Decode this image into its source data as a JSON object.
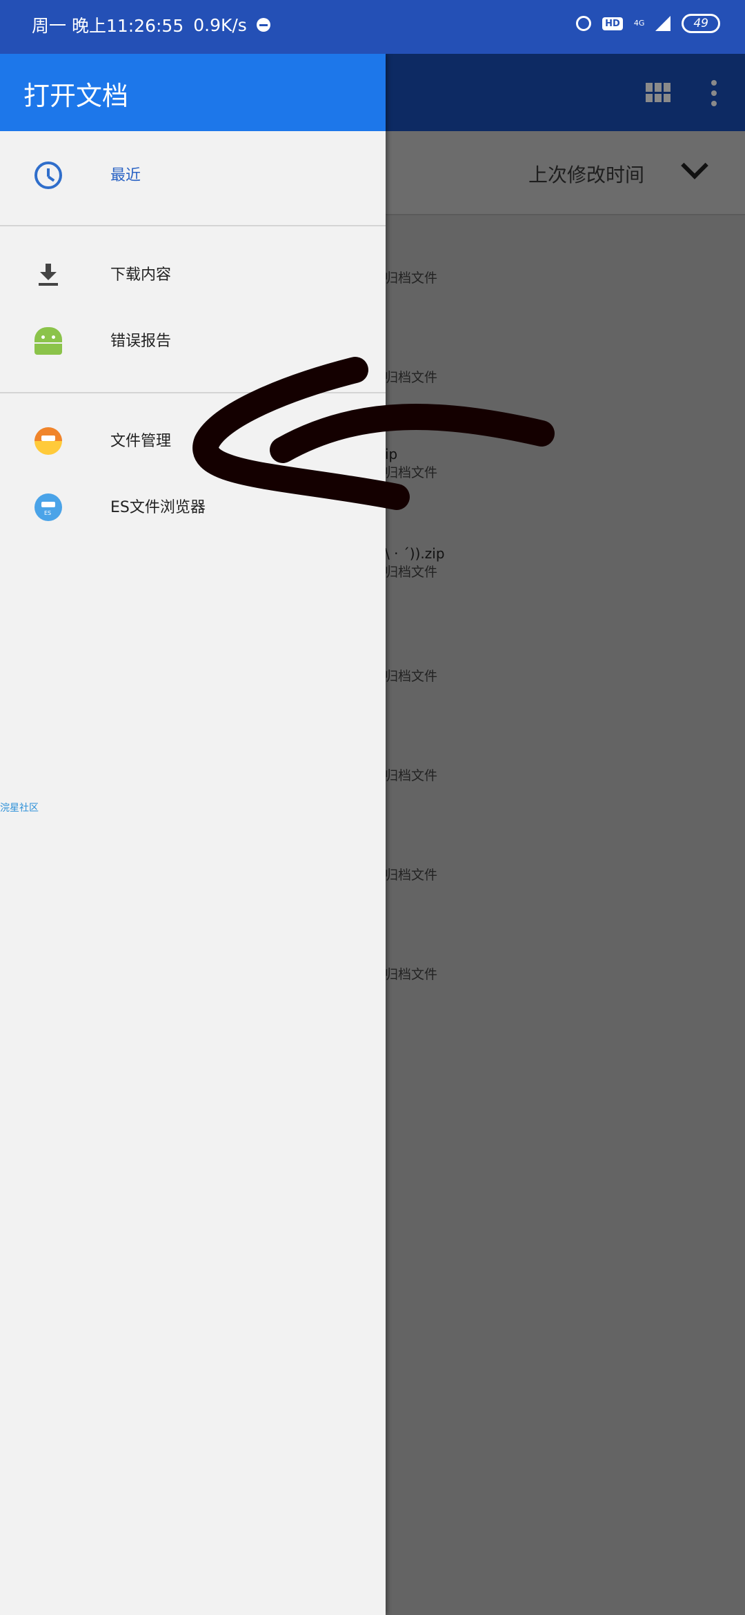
{
  "status_bar": {
    "time": "周一 晚上11:26:55",
    "speed": "0.9K/s",
    "hd": "HD",
    "network": "4G",
    "battery": "49"
  },
  "drawer": {
    "title": "打开文档",
    "items": [
      {
        "label": "最近",
        "icon": "clock-icon",
        "active": true
      },
      {
        "label": "下载内容",
        "icon": "download-icon"
      },
      {
        "label": "错误报告",
        "icon": "android-icon"
      },
      {
        "label": "文件管理",
        "icon": "file-manager-icon"
      },
      {
        "label": "ES文件浏览器",
        "icon": "es-file-explorer-icon"
      }
    ],
    "footer_link": "浣星社区"
  },
  "background": {
    "sort_label": "上次修改时间",
    "files": [
      {
        "name": "",
        "type": "归档文件"
      },
      {
        "name": "",
        "type": "归档文件"
      },
      {
        "name": "ip",
        "type": "归档文件"
      },
      {
        "name": "\\ · ´)).zip",
        "type": "归档文件"
      },
      {
        "name": "",
        "type": "归档文件"
      },
      {
        "name": "",
        "type": "归档文件"
      },
      {
        "name": "",
        "type": "归档文件"
      },
      {
        "name": "",
        "type": "归档文件"
      }
    ]
  },
  "colors": {
    "status_bar": "#2450b6",
    "drawer_header": "#1d77ea",
    "active_label": "#2a63c4"
  }
}
